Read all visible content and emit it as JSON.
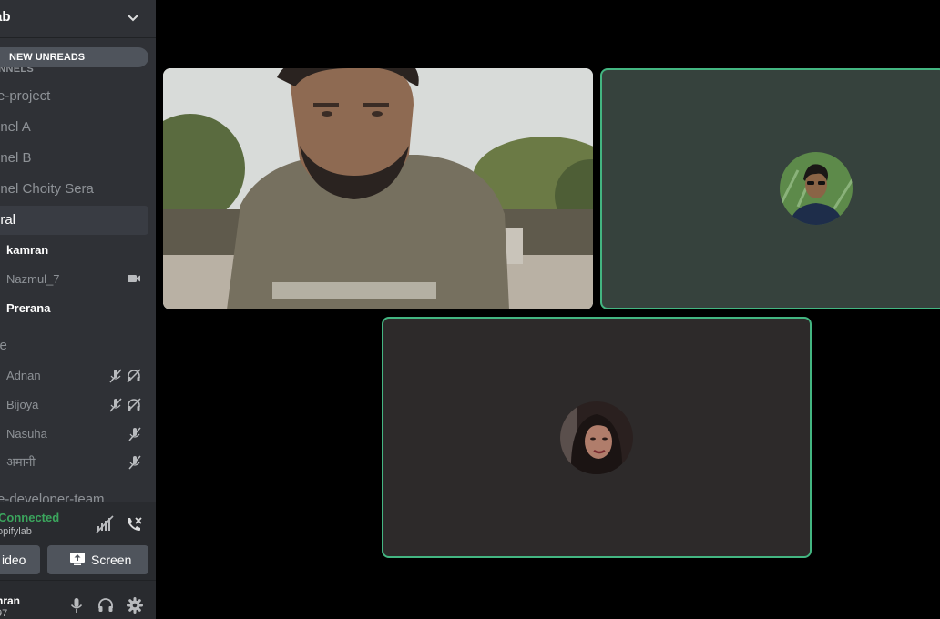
{
  "server": {
    "name": "ab"
  },
  "unreads_label": "NEW UNREADS",
  "category_label": "ANNELS",
  "channels": [
    {
      "name": "re-project"
    },
    {
      "name": "nnel A"
    },
    {
      "name": "nnel B"
    },
    {
      "name": "nnel Choity Sera"
    },
    {
      "name": "eral"
    }
  ],
  "general_members": [
    {
      "name": "kamran"
    },
    {
      "name": "Nazmul_7"
    },
    {
      "name": "Prerana"
    }
  ],
  "voice_channel": {
    "name": "ce"
  },
  "voice_members": [
    {
      "name": "Adnan"
    },
    {
      "name": "Bijoya"
    },
    {
      "name": "Nasuha"
    },
    {
      "name": "अमानी"
    }
  ],
  "next_channel": "re-developer-team",
  "voice_status": {
    "status": "Connected",
    "server": "opifylab",
    "video_label": "ideo",
    "screen_label": "Screen"
  },
  "user": {
    "name": "nran",
    "tag": "97"
  },
  "colors": {
    "sidebar": "#2f3136",
    "connected": "#3ba55d",
    "speaking_border": "#43b581",
    "stage": "#000000"
  },
  "icons": [
    "chevron-down-icon",
    "camera-icon",
    "mute-icon",
    "deafen-icon",
    "voice-signal-icon",
    "disconnect-icon",
    "screen-share-icon",
    "mic-icon",
    "headphones-icon",
    "settings-icon"
  ]
}
